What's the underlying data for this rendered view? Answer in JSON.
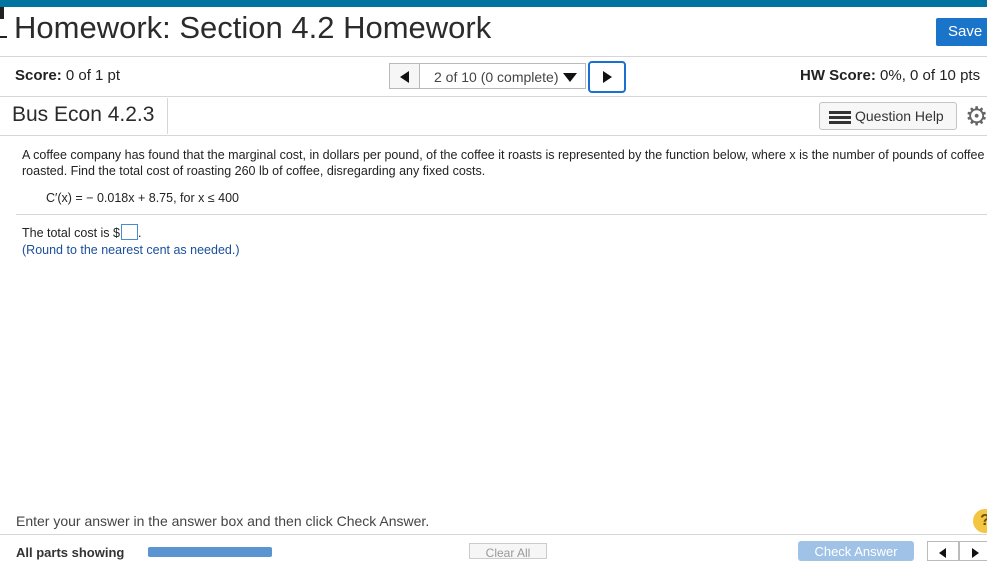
{
  "header": {
    "title": "Homework: Section 4.2 Homework",
    "save_label": "Save"
  },
  "score_bar": {
    "score_label": "Score:",
    "score_value": "0 of 1 pt",
    "question_selector": "2 of 10 (0 complete)",
    "hw_score_label": "HW Score:",
    "hw_score_value": "0%, 0 of 10 pts"
  },
  "section": {
    "name": "Bus Econ 4.2.3",
    "question_help_label": "Question Help"
  },
  "problem": {
    "text": "A coffee company has found that the marginal cost, in dollars per pound, of the coffee it roasts is represented by the function below, where x is the number of pounds of coffee roasted. Find the total cost of roasting 260 lb of coffee, disregarding any fixed costs.",
    "formula": "C′(x) = − 0.018x + 8.75, for x ≤ 400"
  },
  "answer": {
    "prefix": "The total cost is $",
    "value": "",
    "suffix": ".",
    "note": "(Round to the nearest cent as needed.)"
  },
  "footer": {
    "instruction": "Enter your answer in the answer box and then click Check Answer.",
    "all_parts_label": "All parts showing",
    "clear_all_label": "Clear All",
    "check_answer_label": "Check Answer",
    "help_symbol": "?"
  },
  "icons": {
    "prev": "triangle-left-icon",
    "next": "triangle-right-icon",
    "dropdown": "caret-down-icon",
    "question_help": "list-icon",
    "settings": "gear-icon"
  },
  "colors": {
    "accent_blue": "#1a74c9",
    "top_bar": "#00749e",
    "note_blue": "#1a4f9c",
    "help_yellow": "#f4c542"
  }
}
